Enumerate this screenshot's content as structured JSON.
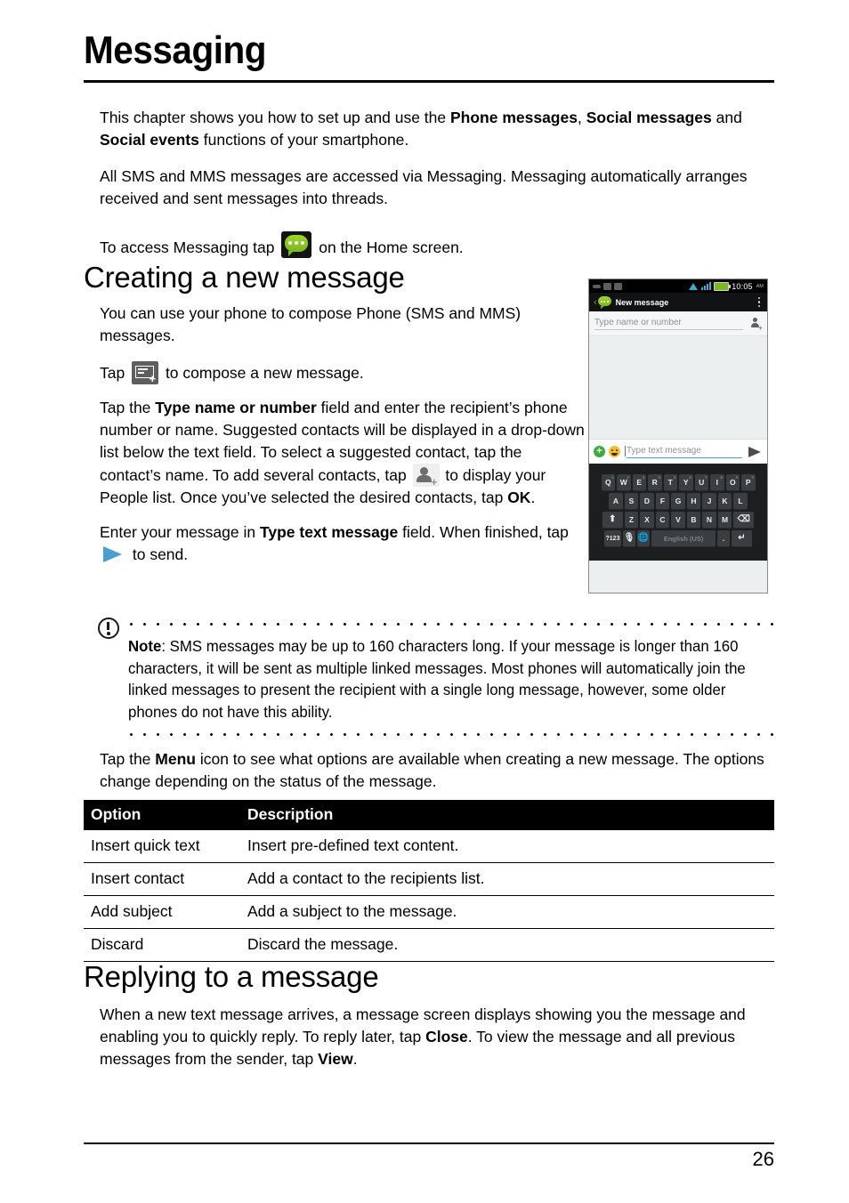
{
  "chapter": {
    "title": "Messaging"
  },
  "intro": {
    "p1_a": "This chapter shows you how to set up and use the ",
    "p1_b1": "Phone messages",
    "p1_c": ", ",
    "p1_b2": "Social messages",
    "p1_d": " and ",
    "p1_b3": "Social events",
    "p1_e": " functions of your smartphone.",
    "p2": "All SMS and MMS messages are accessed via Messaging. Messaging automatically arranges received and sent messages into threads.",
    "p3_a": "To access Messaging tap ",
    "p3_b": " on the Home screen."
  },
  "creating": {
    "heading": "Creating a new message",
    "p1": "You can use your phone to compose Phone (SMS and MMS) messages.",
    "p2_a": "Tap ",
    "p2_b": " to compose a new message.",
    "p3_a": "Tap the ",
    "p3_bold1": "Type name or number",
    "p3_b": " field and enter the recipient’s phone number or name. Suggested contacts will be displayed in a drop-down list below the text field. To select a suggested contact, tap the contact’s name. To add several contacts, tap ",
    "p3_c": " to display your People list. Once you’ve selected the desired contacts, tap ",
    "p3_bold2": "OK",
    "p3_d": ".",
    "p4_a": "Enter your message in ",
    "p4_bold": "Type text message",
    "p4_b": " field. When finished, tap ",
    "p4_c": " to send."
  },
  "note": {
    "label": "Note",
    "text": ": SMS messages may be up to 160 characters long. If your message is longer than 160 characters, it will be sent as multiple linked messages. Most phones will automatically join the linked messages to present the recipient with a single long message, however, some older phones do not have this ability."
  },
  "menu_intro": {
    "a": "Tap the ",
    "bold": "Menu",
    "b": " icon to see what options are available when creating a new message. The options change depending on the status of the message."
  },
  "options_table": {
    "headers": [
      "Option",
      "Description"
    ],
    "rows": [
      [
        "Insert quick text",
        "Insert pre-defined text content."
      ],
      [
        "Insert contact",
        "Add a contact to the recipients list."
      ],
      [
        "Add subject",
        "Add a subject to the message."
      ],
      [
        "Discard",
        "Discard the message."
      ]
    ]
  },
  "replying": {
    "heading": "Replying to a message",
    "p1_a": "When a new text message arrives, a message screen displays showing you the message and enabling you to quickly reply. To reply later, tap ",
    "p1_bold1": "Close",
    "p1_b": ". To view the message and all previous messages from the sender, tap ",
    "p1_bold2": "View",
    "p1_c": "."
  },
  "phone_screenshot": {
    "status_bar": {
      "time": "10:05",
      "ampm": "AM"
    },
    "action_bar": {
      "title": "New message"
    },
    "recipient_field": {
      "placeholder": "Type name or number"
    },
    "compose_field": {
      "placeholder": "Type text message"
    },
    "keyboard": {
      "row1": [
        {
          "key": "Q",
          "sup": "1"
        },
        {
          "key": "W",
          "sup": "2"
        },
        {
          "key": "E",
          "sup": "3"
        },
        {
          "key": "R",
          "sup": "4"
        },
        {
          "key": "T",
          "sup": "5"
        },
        {
          "key": "Y",
          "sup": "6"
        },
        {
          "key": "U",
          "sup": "7"
        },
        {
          "key": "I",
          "sup": "8"
        },
        {
          "key": "O",
          "sup": "9"
        },
        {
          "key": "P",
          "sup": "0"
        }
      ],
      "row2": [
        "A",
        "S",
        "D",
        "F",
        "G",
        "H",
        "J",
        "K",
        "L"
      ],
      "row3": [
        "Z",
        "X",
        "C",
        "V",
        "B",
        "N",
        "M"
      ],
      "numeric_key": "?123",
      "space_label": "English (US)",
      "period_key": "."
    }
  },
  "footer": {
    "page_number": "26"
  },
  "colors": {
    "accent_green": "#7ab81e",
    "accent_blue": "#3fa9d0",
    "send_blue": "#4a9fd0",
    "table_header_bg": "#000000"
  }
}
